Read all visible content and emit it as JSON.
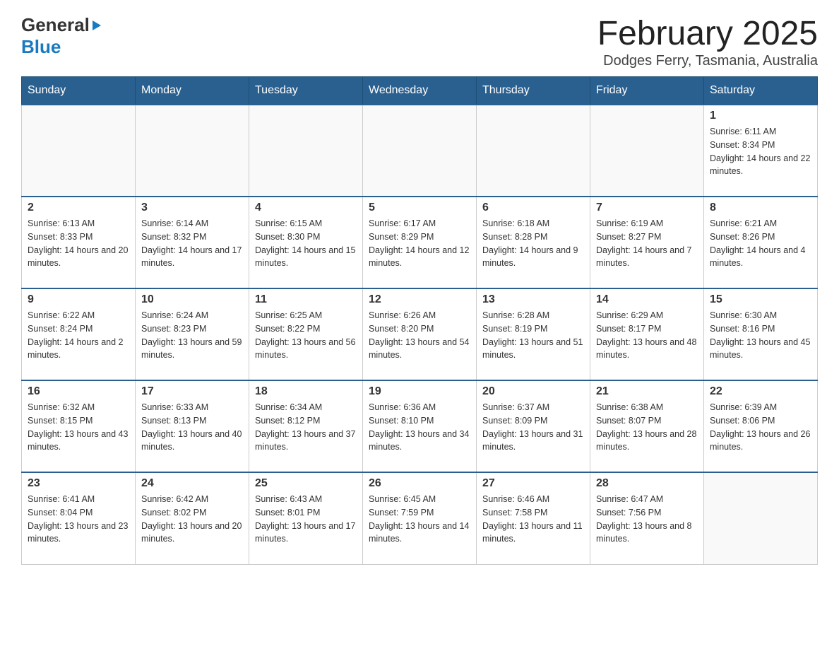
{
  "header": {
    "logo_general": "General",
    "logo_blue": "Blue",
    "main_title": "February 2025",
    "subtitle": "Dodges Ferry, Tasmania, Australia"
  },
  "days_of_week": [
    "Sunday",
    "Monday",
    "Tuesday",
    "Wednesday",
    "Thursday",
    "Friday",
    "Saturday"
  ],
  "weeks": [
    [
      {
        "day": "",
        "info": ""
      },
      {
        "day": "",
        "info": ""
      },
      {
        "day": "",
        "info": ""
      },
      {
        "day": "",
        "info": ""
      },
      {
        "day": "",
        "info": ""
      },
      {
        "day": "",
        "info": ""
      },
      {
        "day": "1",
        "info": "Sunrise: 6:11 AM\nSunset: 8:34 PM\nDaylight: 14 hours and 22 minutes."
      }
    ],
    [
      {
        "day": "2",
        "info": "Sunrise: 6:13 AM\nSunset: 8:33 PM\nDaylight: 14 hours and 20 minutes."
      },
      {
        "day": "3",
        "info": "Sunrise: 6:14 AM\nSunset: 8:32 PM\nDaylight: 14 hours and 17 minutes."
      },
      {
        "day": "4",
        "info": "Sunrise: 6:15 AM\nSunset: 8:30 PM\nDaylight: 14 hours and 15 minutes."
      },
      {
        "day": "5",
        "info": "Sunrise: 6:17 AM\nSunset: 8:29 PM\nDaylight: 14 hours and 12 minutes."
      },
      {
        "day": "6",
        "info": "Sunrise: 6:18 AM\nSunset: 8:28 PM\nDaylight: 14 hours and 9 minutes."
      },
      {
        "day": "7",
        "info": "Sunrise: 6:19 AM\nSunset: 8:27 PM\nDaylight: 14 hours and 7 minutes."
      },
      {
        "day": "8",
        "info": "Sunrise: 6:21 AM\nSunset: 8:26 PM\nDaylight: 14 hours and 4 minutes."
      }
    ],
    [
      {
        "day": "9",
        "info": "Sunrise: 6:22 AM\nSunset: 8:24 PM\nDaylight: 14 hours and 2 minutes."
      },
      {
        "day": "10",
        "info": "Sunrise: 6:24 AM\nSunset: 8:23 PM\nDaylight: 13 hours and 59 minutes."
      },
      {
        "day": "11",
        "info": "Sunrise: 6:25 AM\nSunset: 8:22 PM\nDaylight: 13 hours and 56 minutes."
      },
      {
        "day": "12",
        "info": "Sunrise: 6:26 AM\nSunset: 8:20 PM\nDaylight: 13 hours and 54 minutes."
      },
      {
        "day": "13",
        "info": "Sunrise: 6:28 AM\nSunset: 8:19 PM\nDaylight: 13 hours and 51 minutes."
      },
      {
        "day": "14",
        "info": "Sunrise: 6:29 AM\nSunset: 8:17 PM\nDaylight: 13 hours and 48 minutes."
      },
      {
        "day": "15",
        "info": "Sunrise: 6:30 AM\nSunset: 8:16 PM\nDaylight: 13 hours and 45 minutes."
      }
    ],
    [
      {
        "day": "16",
        "info": "Sunrise: 6:32 AM\nSunset: 8:15 PM\nDaylight: 13 hours and 43 minutes."
      },
      {
        "day": "17",
        "info": "Sunrise: 6:33 AM\nSunset: 8:13 PM\nDaylight: 13 hours and 40 minutes."
      },
      {
        "day": "18",
        "info": "Sunrise: 6:34 AM\nSunset: 8:12 PM\nDaylight: 13 hours and 37 minutes."
      },
      {
        "day": "19",
        "info": "Sunrise: 6:36 AM\nSunset: 8:10 PM\nDaylight: 13 hours and 34 minutes."
      },
      {
        "day": "20",
        "info": "Sunrise: 6:37 AM\nSunset: 8:09 PM\nDaylight: 13 hours and 31 minutes."
      },
      {
        "day": "21",
        "info": "Sunrise: 6:38 AM\nSunset: 8:07 PM\nDaylight: 13 hours and 28 minutes."
      },
      {
        "day": "22",
        "info": "Sunrise: 6:39 AM\nSunset: 8:06 PM\nDaylight: 13 hours and 26 minutes."
      }
    ],
    [
      {
        "day": "23",
        "info": "Sunrise: 6:41 AM\nSunset: 8:04 PM\nDaylight: 13 hours and 23 minutes."
      },
      {
        "day": "24",
        "info": "Sunrise: 6:42 AM\nSunset: 8:02 PM\nDaylight: 13 hours and 20 minutes."
      },
      {
        "day": "25",
        "info": "Sunrise: 6:43 AM\nSunset: 8:01 PM\nDaylight: 13 hours and 17 minutes."
      },
      {
        "day": "26",
        "info": "Sunrise: 6:45 AM\nSunset: 7:59 PM\nDaylight: 13 hours and 14 minutes."
      },
      {
        "day": "27",
        "info": "Sunrise: 6:46 AM\nSunset: 7:58 PM\nDaylight: 13 hours and 11 minutes."
      },
      {
        "day": "28",
        "info": "Sunrise: 6:47 AM\nSunset: 7:56 PM\nDaylight: 13 hours and 8 minutes."
      },
      {
        "day": "",
        "info": ""
      }
    ]
  ]
}
